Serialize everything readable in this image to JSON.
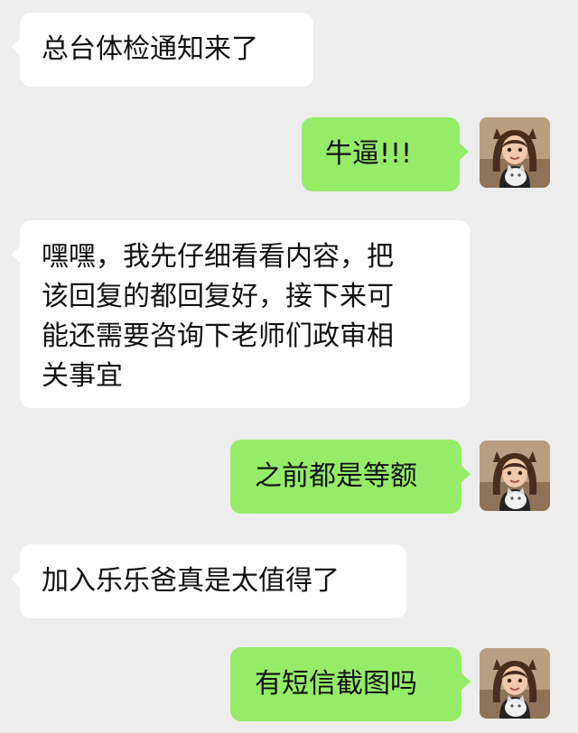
{
  "messages": [
    {
      "side": "left",
      "text": "总台体检通知来了"
    },
    {
      "side": "right",
      "text": "牛逼!!!"
    },
    {
      "side": "left",
      "text": "嘿嘿，我先仔细看看内容，把\n该回复的都回复好，接下来可\n能还需要咨询下老师们政审相\n关事宜"
    },
    {
      "side": "right",
      "text": "之前都是等额"
    },
    {
      "side": "left",
      "text": "加入乐乐爸真是太值得了"
    },
    {
      "side": "right",
      "text": "有短信截图吗"
    }
  ],
  "avatar": {
    "icon": "user-avatar-girl-with-cat"
  }
}
